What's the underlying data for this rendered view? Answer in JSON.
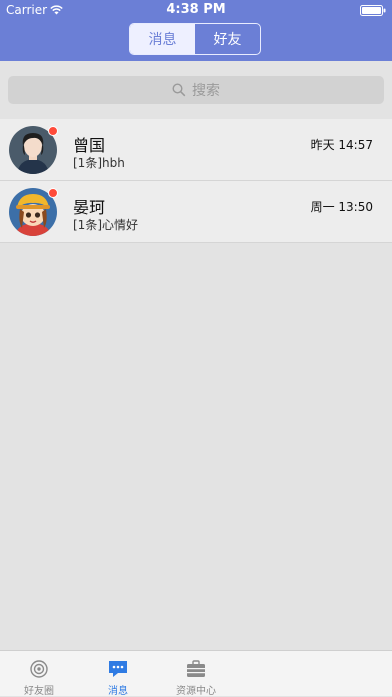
{
  "status_bar": {
    "carrier": "Carrier",
    "time": "4:38 PM"
  },
  "nav": {
    "segments": [
      {
        "label": "消息",
        "active": true
      },
      {
        "label": "好友",
        "active": false
      }
    ]
  },
  "search": {
    "placeholder": "搜索"
  },
  "conversations": [
    {
      "name": "曾国",
      "preview": "[1条]hbh",
      "time": "昨天 14:57",
      "unread": true,
      "avatar": "woman-avatar"
    },
    {
      "name": "晏珂",
      "preview": "[1条]心情好",
      "time": "周一 13:50",
      "unread": true,
      "avatar": "cartoon-girl-avatar"
    }
  ],
  "tabbar": {
    "items": [
      {
        "label": "好友圈",
        "icon": "friends-circle-icon",
        "active": false
      },
      {
        "label": "消息",
        "icon": "chat-bubble-icon",
        "active": true
      },
      {
        "label": "资源中心",
        "icon": "briefcase-icon",
        "active": false
      }
    ]
  },
  "colors": {
    "nav_bg": "#6b7fd6",
    "accent": "#2f7be3",
    "unread_dot": "#ff4b3a"
  }
}
